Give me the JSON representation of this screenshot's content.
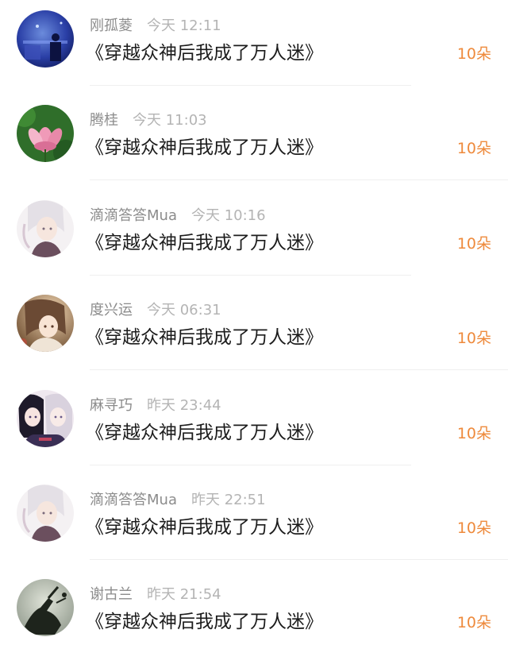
{
  "items": [
    {
      "name": "刚孤菱",
      "time": "今天 12:11",
      "title": "《穿越众神后我成了万人迷》",
      "count": "10朵",
      "avatar": "night-room-avatar"
    },
    {
      "name": "腾桂",
      "time": "今天 11:03",
      "title": "《穿越众神后我成了万人迷》",
      "count": "10朵",
      "avatar": "lotus-flower-avatar"
    },
    {
      "name": "滴滴答答Mua",
      "time": "今天 10:16",
      "title": "《穿越众神后我成了万人迷》",
      "count": "10朵",
      "avatar": "anime-boy-avatar"
    },
    {
      "name": "度兴运",
      "time": "今天 06:31",
      "title": "《穿越众神后我成了万人迷》",
      "count": "10朵",
      "avatar": "anime-girl-avatar"
    },
    {
      "name": "麻寻巧",
      "time": "昨天 23:44",
      "title": "《穿越众神后我成了万人迷》",
      "count": "10朵",
      "avatar": "anime-pair-avatar"
    },
    {
      "name": "滴滴答答Mua",
      "time": "昨天 22:51",
      "title": "《穿越众神后我成了万人迷》",
      "count": "10朵",
      "avatar": "anime-boy-avatar"
    },
    {
      "name": "谢古兰",
      "time": "昨天 21:54",
      "title": "《穿越众神后我成了万人迷》",
      "count": "10朵",
      "avatar": "dark-hand-avatar"
    }
  ],
  "colors": {
    "name": "#8c8c8c",
    "time": "#b4b4b4",
    "title": "#1c1c1c",
    "count_accent": "#ee8a3c",
    "divider": "#efefef"
  }
}
